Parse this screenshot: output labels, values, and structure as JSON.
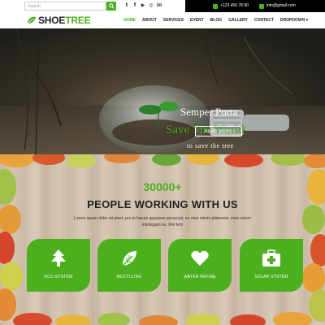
{
  "topbar": {
    "search_placeholder": "Search",
    "social_icons": [
      "twitter-icon",
      "facebook-icon",
      "youtube-icon",
      "instagram-icon",
      "linkedin-icon"
    ],
    "phone": "+123 456 78 90",
    "email": "info@gmail.com"
  },
  "logo": {
    "part1": "SHOE",
    "part2": "TREE"
  },
  "nav": {
    "items": [
      "HOME",
      "ABOUT",
      "SERVICES",
      "EVENT",
      "BLOG",
      "GALLERY",
      "CONTACT",
      "DROPDOWN ▾"
    ],
    "active": "HOME"
  },
  "hero": {
    "subtitle": "Semper Porta",
    "title": "Save The World",
    "text": "to save the tree",
    "button": "READ MORE"
  },
  "stats": {
    "counter": "30000+",
    "heading": "PEOPLE WORKING WITH US",
    "text": "Lorem ipsum dolor sit amet, pro in harum appetere persecuti, eu mea minim platonem, mea cetero intellegam eu. Mel ferri"
  },
  "services": [
    {
      "label": "ECO SYSTEM",
      "icon": "tree-icon"
    },
    {
      "label": "RECYCLING",
      "icon": "leaf-icon"
    },
    {
      "label": "WATER REFINE",
      "icon": "heart-icon"
    },
    {
      "label": "SOLAR SYSTEM",
      "icon": "first-aid-kit-icon"
    }
  ],
  "colors": {
    "accent": "#4caf1e",
    "topbar_dark": "#000000",
    "text_dark": "#222222"
  }
}
